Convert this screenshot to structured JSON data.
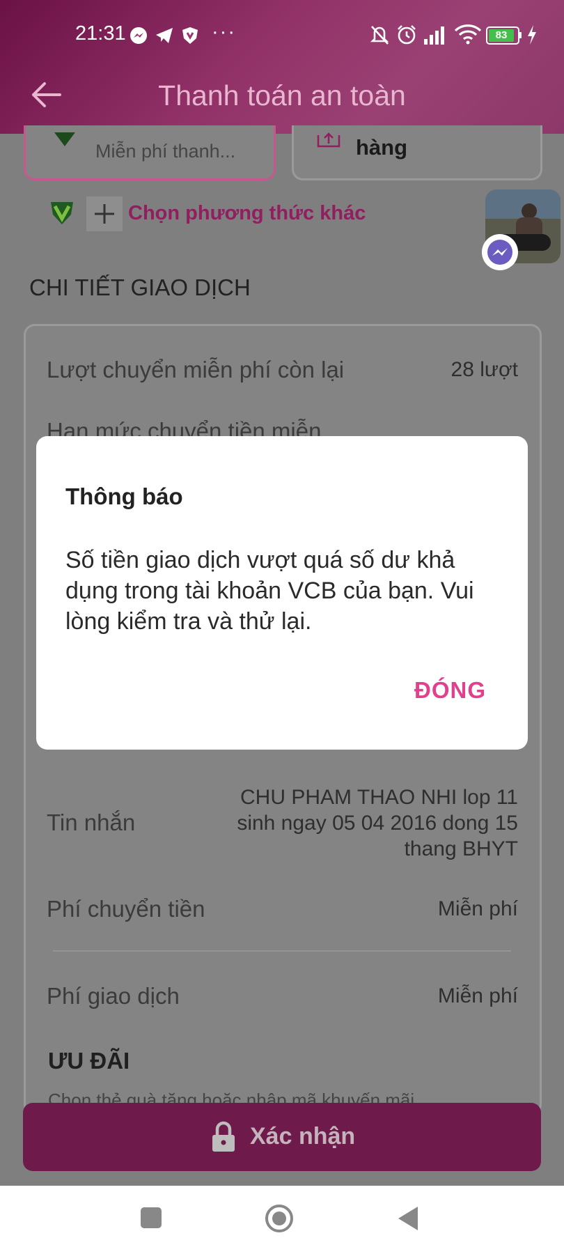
{
  "status_bar": {
    "time": "21:31",
    "battery": "83",
    "dots": "···"
  },
  "header": {
    "title": "Thanh toán an toàn"
  },
  "payment_options": {
    "option1_subtitle": "Miễn phí thanh...",
    "option2_label": "hàng",
    "other_method": "Chọn phương thức khác"
  },
  "details": {
    "section_title": "CHI TIẾT GIAO DỊCH",
    "rows": [
      {
        "label": "Lượt chuyển miễn phí còn lại",
        "value": "28 lượt"
      },
      {
        "label": "Hạn mức chuyển tiền miễn",
        "value": ""
      },
      {
        "label": "Tin nhắn",
        "value_lines": [
          "CHU PHAM THAO NHI lop 11",
          "sinh ngay 05 04 2016 dong 15",
          "thang BHYT"
        ]
      },
      {
        "label": "Phí chuyển tiền",
        "value": "Miễn phí"
      },
      {
        "label": "Phí giao dịch",
        "value": "Miễn phí"
      }
    ]
  },
  "promotion": {
    "title": "ƯU ĐÃI",
    "subtitle": "Chọn thẻ quà tặng hoặc nhập mã khuyến mãi"
  },
  "confirm_button": {
    "label": "Xác nhận"
  },
  "dialog": {
    "title": "Thông báo",
    "message": "Số tiền giao dịch vượt quá số dư khả dụng trong tài khoản VCB của bạn. Vui lòng kiểm tra và thử lại.",
    "button": "ĐÓNG"
  },
  "colors": {
    "accent": "#e0408c",
    "header": "#a73a78",
    "confirm": "#8e1f5a"
  }
}
